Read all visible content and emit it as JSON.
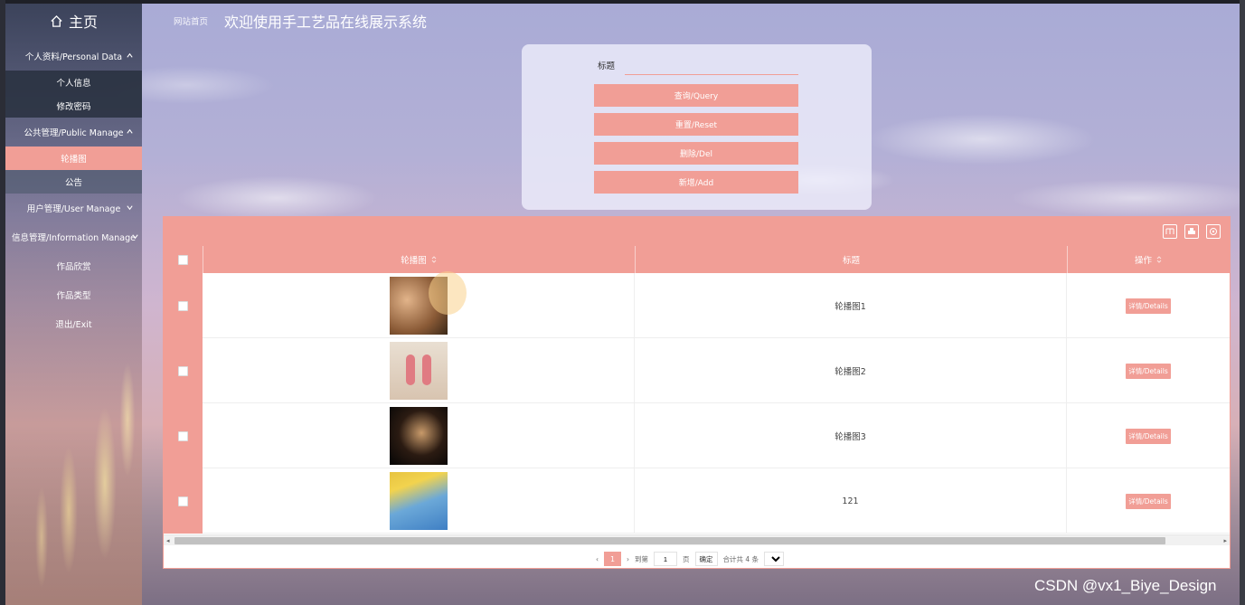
{
  "sidebar": {
    "home_label": "主页",
    "groups": [
      {
        "label": "个人资料/Personal Data",
        "items": [
          "个人信息",
          "修改密码"
        ]
      },
      {
        "label": "公共管理/Public Manage",
        "items": [
          "轮播图",
          "公告"
        ]
      },
      {
        "label": "用户管理/User Manage"
      },
      {
        "label": "信息管理/Information Manage"
      }
    ],
    "items": [
      "作品欣赏",
      "作品类型",
      "退出/Exit"
    ]
  },
  "header": {
    "breadcrumb": "网站首页",
    "title": "欢迎使用手工艺品在线展示系统"
  },
  "search": {
    "label": "标题",
    "value": "",
    "query_btn": "查询/Query",
    "reset_btn": "重置/Reset",
    "delete_btn": "删除/Del",
    "add_btn": "新增/Add"
  },
  "table": {
    "columns": [
      "轮播图",
      "标题",
      "操作"
    ],
    "rows": [
      {
        "title": "轮播图1",
        "action": "详情/Details"
      },
      {
        "title": "轮播图2",
        "action": "详情/Details"
      },
      {
        "title": "轮播图3",
        "action": "详情/Details"
      },
      {
        "title": "121",
        "action": "详情/Details"
      }
    ]
  },
  "pager": {
    "current": "1",
    "goto_label": "到第",
    "goto_value": "1",
    "page_unit": "页",
    "confirm": "确定",
    "total": "合计共 4 条"
  },
  "watermark": "CSDN @vx1_Biye_Design",
  "colors": {
    "accent": "#f19e96"
  }
}
